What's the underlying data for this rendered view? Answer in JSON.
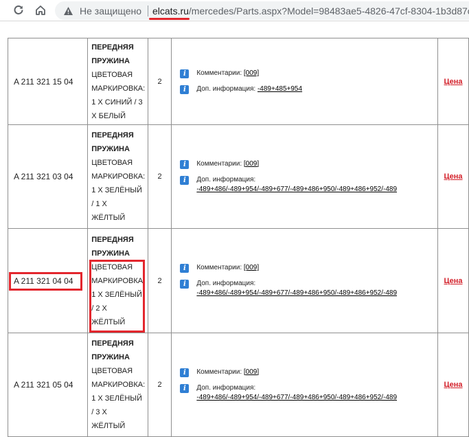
{
  "browser": {
    "security_label": "Не защищено",
    "url_host": "elcats.ru",
    "url_rest": "/mercedes/Parts.aspx?Model=98483ae5-4826-47cf-8304-1b3d87c"
  },
  "table": {
    "rows": [
      {
        "part_number": "A  211 321 15 04",
        "name_lines": [
          "ПЕРЕДНЯЯ",
          "ПРУЖИНА"
        ],
        "desc_lines": [
          "ЦВЕТОВАЯ",
          "МАРКИРОВКА:",
          "1 Х СИНИЙ / 3",
          "Х БЕЛЫЙ"
        ],
        "qty": "2",
        "comments_label": "Комментарии:",
        "comments_value": "[009]",
        "extra_label": "Доп. информация:",
        "extra_value": "-489+485+954",
        "price": "Цена"
      },
      {
        "part_number": "A  211 321 03 04",
        "name_lines": [
          "ПЕРЕДНЯЯ",
          "ПРУЖИНА"
        ],
        "desc_lines": [
          "ЦВЕТОВАЯ",
          "МАРКИРОВКА:",
          "1 Х ЗЕЛЁНЫЙ",
          "/ 1 Х",
          "ЖЁЛТЫЙ"
        ],
        "qty": "2",
        "comments_label": "Комментарии:",
        "comments_value": "[009]",
        "extra_label": "Доп. информация:",
        "extra_value": "-489+486/-489+954/-489+677/-489+486+950/-489+486+952/-489",
        "price": "Цена"
      },
      {
        "part_number": "A  211 321 04 04",
        "name_lines": [
          "ПЕРЕДНЯЯ",
          "ПРУЖИНА"
        ],
        "desc_lines": [
          "ЦВЕТОВАЯ",
          "МАРКИРОВКА:",
          "1 Х ЗЕЛЁНЫЙ",
          "/ 2 Х",
          "ЖЁЛТЫЙ"
        ],
        "qty": "2",
        "comments_label": "Комментарии:",
        "comments_value": "[009]",
        "extra_label": "Доп. информация:",
        "extra_value": "-489+486/-489+954/-489+677/-489+486+950/-489+486+952/-489",
        "price": "Цена"
      },
      {
        "part_number": "A  211 321 05 04",
        "name_lines": [
          "ПЕРЕДНЯЯ",
          "ПРУЖИНА"
        ],
        "desc_lines": [
          "ЦВЕТОВАЯ",
          "МАРКИРОВКА:",
          "1 Х ЗЕЛЁНЫЙ",
          "/ 3 Х",
          "ЖЁЛТЫЙ"
        ],
        "qty": "2",
        "comments_label": "Комментарии:",
        "comments_value": "[009]",
        "extra_label": "Доп. информация:",
        "extra_value": "-489+486/-489+954/-489+677/-489+486+950/-489+486+952/-489",
        "price": "Цена"
      }
    ]
  },
  "colors": {
    "annotation_red": "#e3262d",
    "price_red": "#d3202a",
    "info_icon_blue": "#2f7fd4"
  }
}
